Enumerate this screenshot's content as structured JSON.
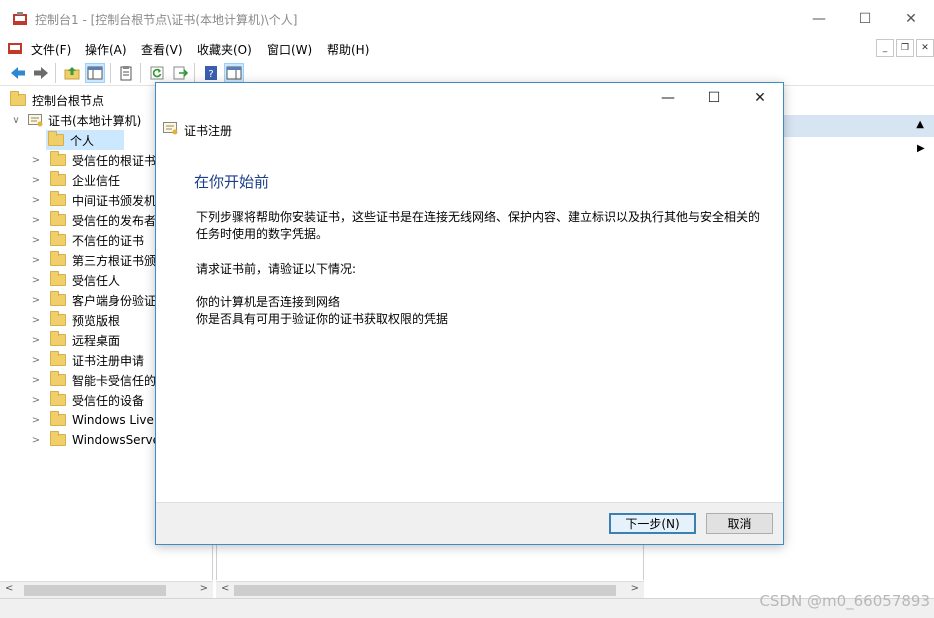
{
  "window": {
    "title": "控制台1 - [控制台根节点\\证书(本地计算机)\\个人]"
  },
  "menu": [
    "文件(F)",
    "操作(A)",
    "查看(V)",
    "收藏夹(O)",
    "窗口(W)",
    "帮助(H)"
  ],
  "tree": {
    "root": "控制台根节点",
    "cert_node": "证书(本地计算机)",
    "items": [
      "个人",
      "受信任的根证书颁发机构",
      "企业信任",
      "中间证书颁发机构",
      "受信任的发布者",
      "不信任的证书",
      "第三方根证书颁发机构",
      "受信任人",
      "客户端身份验证颁发者",
      "预览版根",
      "远程桌面",
      "证书注册申请",
      "智能卡受信任的根",
      "受信任的设备",
      "Windows Live ID Token Issuer",
      "WindowsServerUpdateServices"
    ]
  },
  "dialog": {
    "title": "证书注册",
    "heading": "在你开始前",
    "para1_line1": "下列步骤将帮助你安装证书，这些证书是在连接无线网络、保护内容、建立标识以及执行其他与安全相关的",
    "para1_line2": "任务时使用的数字凭据。",
    "para2": "请求证书前，请验证以下情况:",
    "check1": "你的计算机是否连接到网络",
    "check2": "你是否具有可用于验证你的证书获取权限的凭据",
    "next_button": "下一步(N)",
    "cancel_button": "取消"
  },
  "watermark": "CSDN @m0_66057893",
  "icons": {
    "back": "arrow-left-icon",
    "forward": "arrow-right-icon",
    "up": "folder-up-icon",
    "show_hide_tree": "console-tree-icon",
    "properties": "clipboard-icon",
    "refresh": "refresh-icon",
    "export": "export-list-icon",
    "help": "help-icon",
    "action_pane": "action-pane-icon"
  },
  "colors": {
    "dialog_border": "#3c8dc6",
    "heading": "#1b3e8a",
    "selection": "#cce8ff",
    "action_header": "#d7e4f2"
  }
}
